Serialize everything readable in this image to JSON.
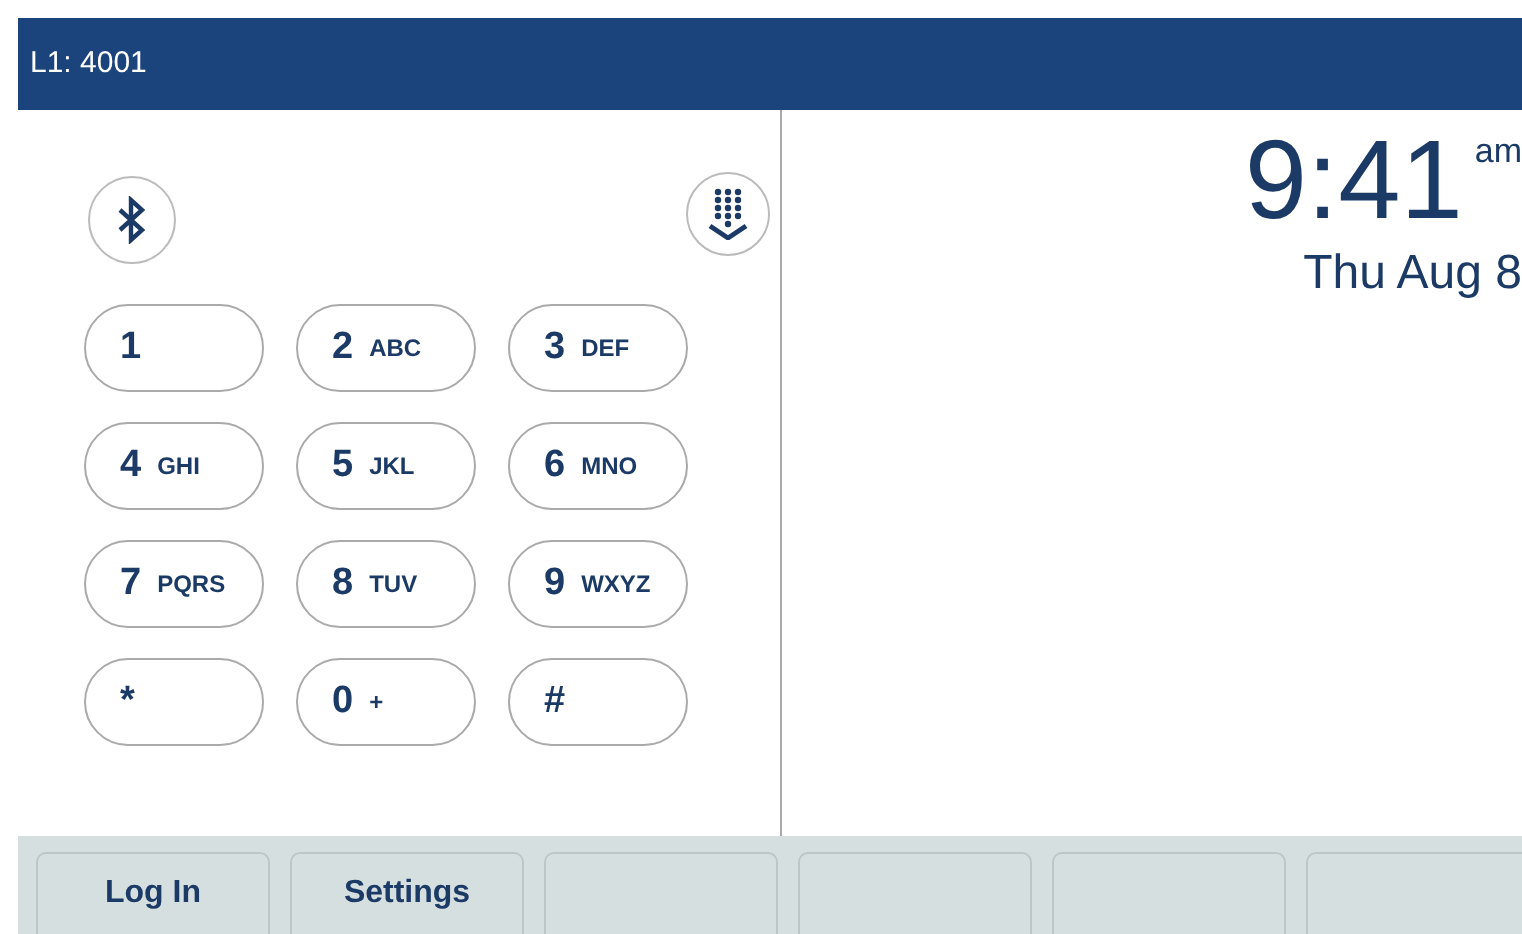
{
  "header": {
    "line": "L1: 4001"
  },
  "keypad": [
    {
      "digit": "1"
    },
    {
      "digit": "2",
      "letters": "ABC"
    },
    {
      "digit": "3",
      "letters": "DEF"
    },
    {
      "digit": "4",
      "letters": "GHI"
    },
    {
      "digit": "5",
      "letters": "JKL"
    },
    {
      "digit": "6",
      "letters": "MNO"
    },
    {
      "digit": "7",
      "letters": "PQRS"
    },
    {
      "digit": "8",
      "letters": "TUV"
    },
    {
      "digit": "9",
      "letters": "WXYZ"
    },
    {
      "digit": "*"
    },
    {
      "digit": "0",
      "letters": "+"
    },
    {
      "digit": "#"
    }
  ],
  "clock": {
    "time": "9:41",
    "meridiem": "am",
    "date": "Thu Aug 8"
  },
  "softkeys": [
    {
      "label": "Log In"
    },
    {
      "label": "Settings"
    }
  ]
}
